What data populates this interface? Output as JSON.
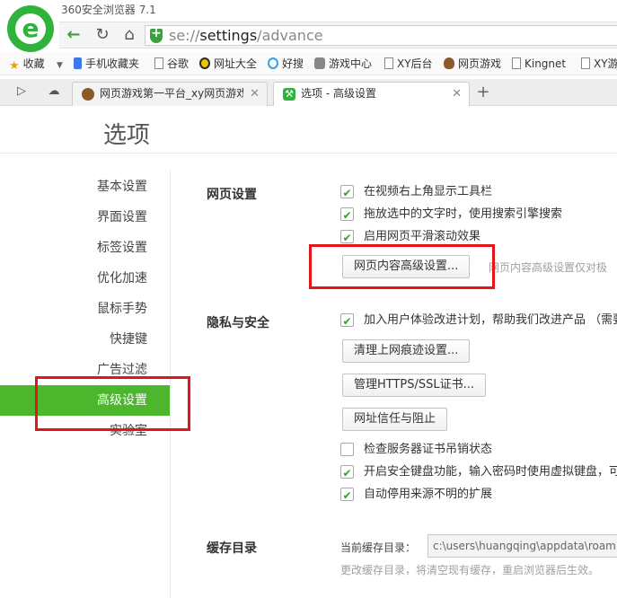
{
  "window": {
    "title": "360安全浏览器 7.1"
  },
  "brand": {
    "logo_letter": "e",
    "accent": "#2fb33c",
    "active_nav": "#4cb62d",
    "highlight": "#e5141b"
  },
  "address_bar": {
    "scheme": "se://",
    "path": "settings",
    "sub": "/advance"
  },
  "bookmarks": [
    {
      "label": "收藏",
      "icon": "star-icon"
    },
    {
      "label": "手机收藏夹",
      "icon": "phone-icon"
    },
    {
      "label": "谷歌",
      "icon": "page-icon"
    },
    {
      "label": "网址大全",
      "icon": "globe-icon"
    },
    {
      "label": "好搜",
      "icon": "search-q-icon"
    },
    {
      "label": "游戏中心",
      "icon": "gamepad-icon"
    },
    {
      "label": "XY后台",
      "icon": "page-icon"
    },
    {
      "label": "网页游戏",
      "icon": "pet-icon"
    },
    {
      "label": "Kingnet",
      "icon": "page-icon"
    },
    {
      "label": "XY游",
      "icon": "page-icon"
    }
  ],
  "tabs": [
    {
      "label": "网页游戏第一平台_xy网页游戏:",
      "icon": "pet-icon"
    },
    {
      "label": "选项 - 高级设置",
      "icon": "settings-icon"
    }
  ],
  "page": {
    "title": "选项"
  },
  "sidebar": {
    "items": [
      "基本设置",
      "界面设置",
      "标签设置",
      "优化加速",
      "鼠标手势",
      "快捷键",
      "广告过滤",
      "高级设置",
      "实验室"
    ],
    "active": "高级设置"
  },
  "web_settings": {
    "title": "网页设置",
    "options": [
      {
        "label": "在视频右上角显示工具栏",
        "checked": true
      },
      {
        "label": "拖放选中的文字时，使用搜索引擎搜索",
        "checked": true
      },
      {
        "label": "启用网页平滑滚动效果",
        "checked": true
      }
    ],
    "content_button": "网页内容高级设置...",
    "content_hint": "网页内容高级设置仅对极"
  },
  "privacy": {
    "title": "隐私与安全",
    "ux_option": {
      "label": "加入用户体验改进计划，帮助我们改进产品 （需要",
      "checked": true
    },
    "buttons": [
      "清理上网痕迹设置...",
      "管理HTTPS/SSL证书...",
      "网址信任与阻止"
    ],
    "options": [
      {
        "label": "检查服务器证书吊销状态",
        "checked": false
      },
      {
        "label": "开启安全键盘功能，输入密码时使用虚拟键盘，可",
        "checked": true
      },
      {
        "label": "自动停用来源不明的扩展",
        "checked": true
      }
    ]
  },
  "cache": {
    "title": "缓存目录",
    "label": "当前缓存目录：",
    "path": "c:\\users\\huangqing\\appdata\\roaming",
    "hint": "更改缓存目录，将清空现有缓存，重启浏览器后生效。"
  }
}
